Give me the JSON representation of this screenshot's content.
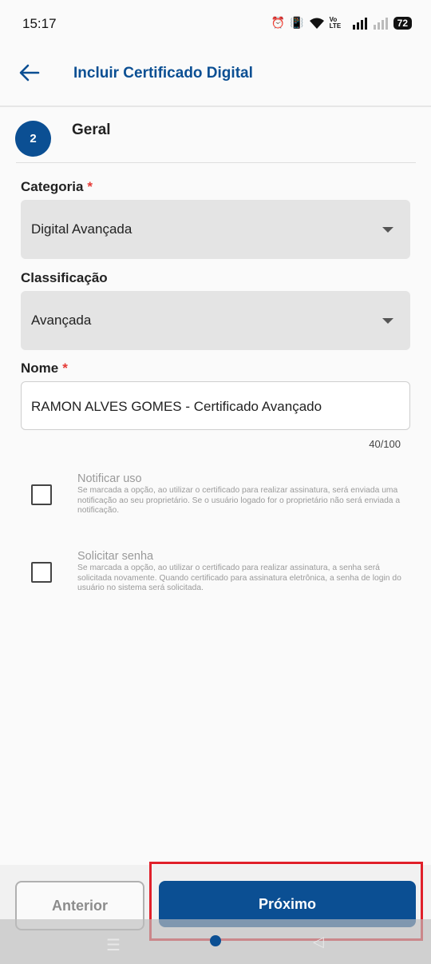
{
  "status_bar": {
    "time": "15:17",
    "battery": "72",
    "volte": "Vo LTE"
  },
  "app_bar": {
    "title": "Incluir Certificado Digital"
  },
  "step": {
    "number": "2",
    "title": "Geral"
  },
  "form": {
    "categoria": {
      "label": "Categoria",
      "required": "*",
      "value": "Digital Avançada"
    },
    "classificacao": {
      "label": "Classificação",
      "value": "Avançada"
    },
    "nome": {
      "label": "Nome",
      "required": "*",
      "value": "RAMON ALVES GOMES - Certificado Avançado",
      "counter": "40/100"
    },
    "notificar_uso": {
      "title": "Notificar uso",
      "description": "Se marcada a opção, ao utilizar o certificado para realizar assinatura, será enviada uma notificação ao seu proprietário. Se o usuário logado for o proprietário não será enviada a notificação."
    },
    "solicitar_senha": {
      "title": "Solicitar senha",
      "description": "Se marcada a opção, ao utilizar o certificado para realizar assinatura, a senha será solicitada novamente. Quando certificado para assinatura eletrônica, a senha de login do usuário no sistema será solicitada."
    }
  },
  "buttons": {
    "anterior": "Anterior",
    "proximo": "Próximo"
  },
  "colors": {
    "primary": "#0b4f93",
    "required": "#e53935",
    "highlight": "#e0202a"
  }
}
